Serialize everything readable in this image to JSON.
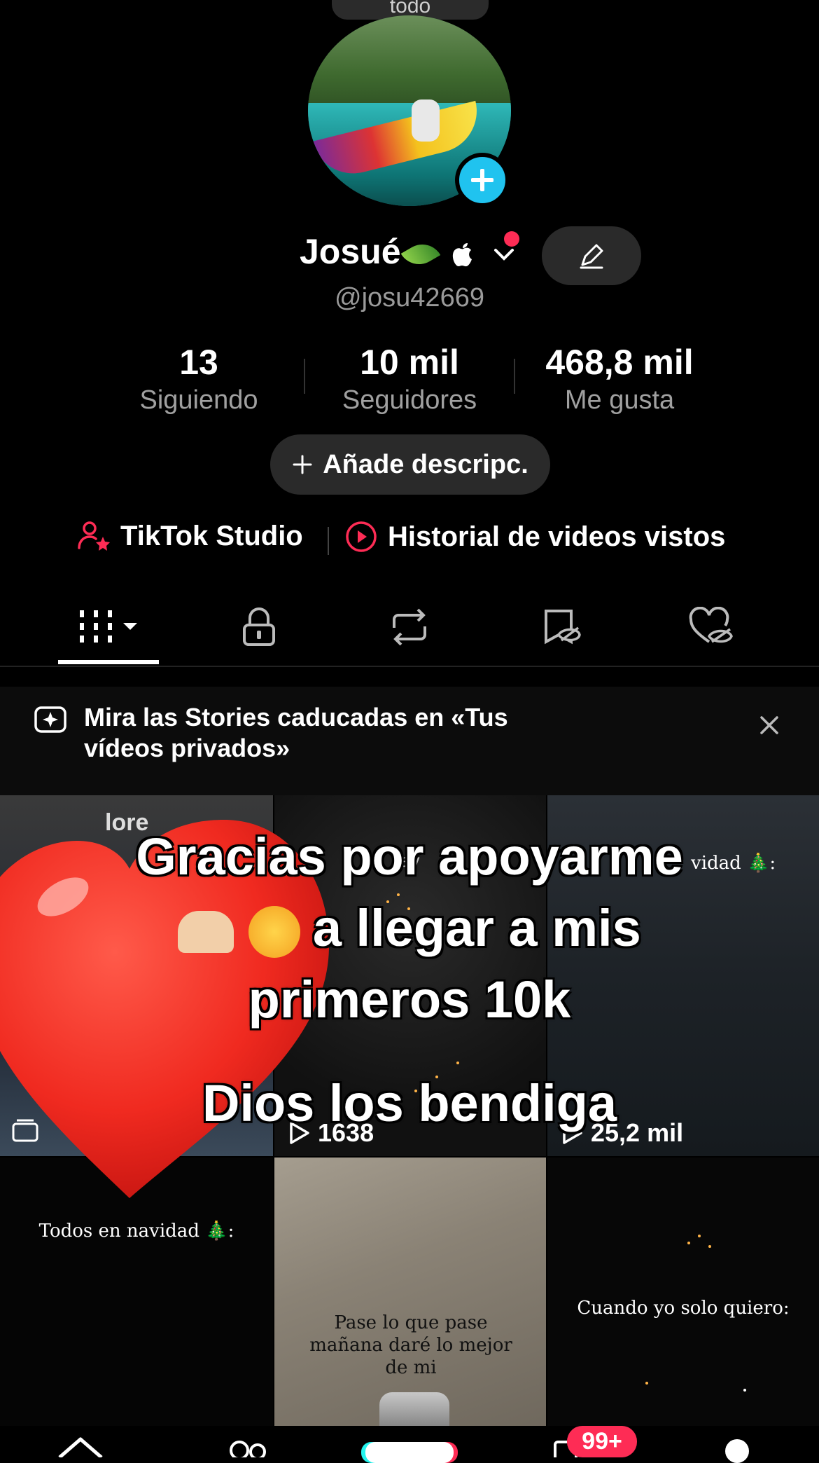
{
  "top_pill": {
    "label": "todo"
  },
  "profile": {
    "name": "Josué",
    "handle": "@josu42669"
  },
  "stats": [
    {
      "value": "13",
      "label": "Siguiendo"
    },
    {
      "value": "10 mil",
      "label": "Seguidores"
    },
    {
      "value": "468,8 mil",
      "label": "Me gusta"
    }
  ],
  "add_description": {
    "label": "Añade descripc."
  },
  "links": {
    "studio": "TikTok Studio",
    "history": "Historial de videos vistos"
  },
  "banner": {
    "text": "Mira las Stories caducadas en «Tus vídeos privados»"
  },
  "overlay": {
    "line1": "Gracias por apoyarme",
    "line2": "a llegar a mis",
    "line3": "primeros 10k",
    "line4": "Dios los bendiga"
  },
  "grid": {
    "cell1_text": "lore",
    "cell2_text": "av",
    "cell2_count": "1638",
    "cell3_text": "vidad 🎄:",
    "cell3_count": "25,2 mil",
    "cell4_text": "Todos en navidad 🎄:",
    "cell5_text": "Pase lo que pase mañana daré lo mejor de mi",
    "cell6_text": "Cuando yo solo quiero:"
  },
  "nav": {
    "inbox_badge": "99+"
  },
  "colors": {
    "accent": "#fe2c55",
    "blue": "#20c3ef",
    "background": "#000000"
  }
}
